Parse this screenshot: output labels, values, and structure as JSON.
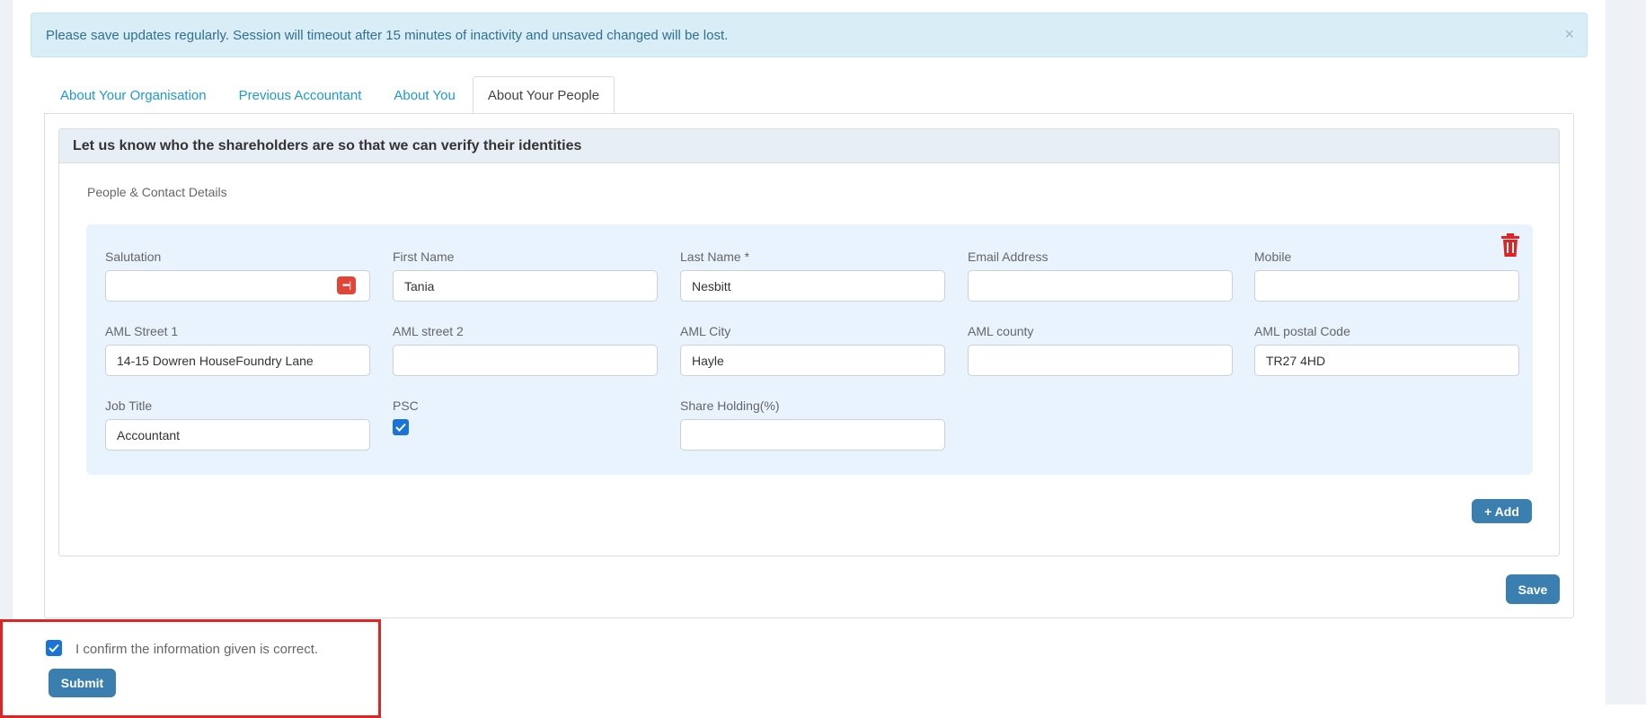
{
  "alert": {
    "message": "Please save updates regularly. Session will timeout after 15 minutes of inactivity and unsaved changed will be lost.",
    "close": "×"
  },
  "tabs": [
    {
      "label": "About Your Organisation",
      "active": false
    },
    {
      "label": "Previous Accountant",
      "active": false
    },
    {
      "label": "About You",
      "active": false
    },
    {
      "label": "About Your People",
      "active": true
    }
  ],
  "card": {
    "header": "Let us know who the shareholders are so that we can verify their identities",
    "section_title": "People & Contact Details"
  },
  "person": {
    "fields": {
      "salutation": {
        "label": "Salutation",
        "value": ""
      },
      "first_name": {
        "label": "First Name",
        "value": "Tania"
      },
      "last_name": {
        "label": "Last Name *",
        "value": "Nesbitt"
      },
      "email": {
        "label": "Email Address",
        "value": ""
      },
      "mobile": {
        "label": "Mobile",
        "value": ""
      },
      "street1": {
        "label": "AML Street 1",
        "value": "14-15 Dowren HouseFoundry Lane"
      },
      "street2": {
        "label": "AML street 2",
        "value": ""
      },
      "city": {
        "label": "AML City",
        "value": "Hayle"
      },
      "county": {
        "label": "AML county",
        "value": ""
      },
      "postal": {
        "label": "AML postal Code",
        "value": "TR27 4HD"
      },
      "job_title": {
        "label": "Job Title",
        "value": "Accountant"
      },
      "psc": {
        "label": "PSC",
        "checked": true
      },
      "share": {
        "label": "Share Holding(%)",
        "value": ""
      }
    }
  },
  "buttons": {
    "add": "+ Add",
    "save": "Save",
    "submit": "Submit"
  },
  "confirm": {
    "label": "I confirm the information given is correct.",
    "checked": true
  },
  "colors": {
    "accent": "#3a7fb0",
    "link": "#1a9ad6",
    "danger": "#e02424",
    "alert_bg": "#d9edf7"
  }
}
